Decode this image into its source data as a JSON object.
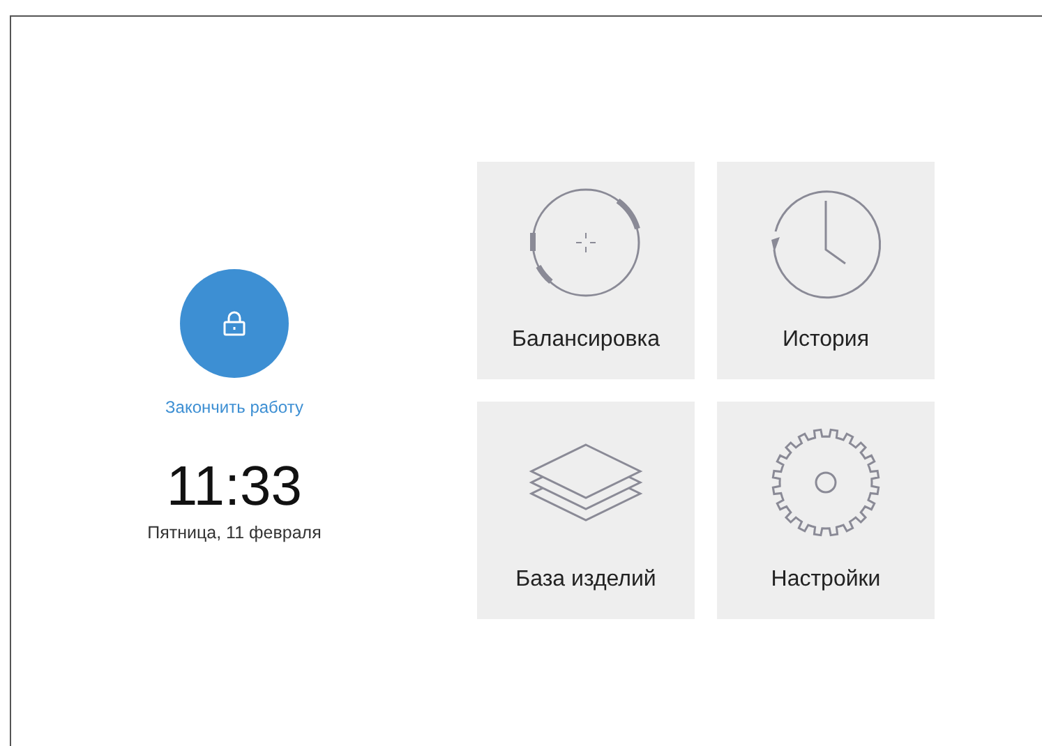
{
  "lock": {
    "label": "Закончить работу"
  },
  "clock": {
    "time": "11:33",
    "date": "Пятница, 11 февраля"
  },
  "tiles": [
    {
      "kind": "balancing",
      "label": "Балансировка"
    },
    {
      "kind": "history",
      "label": "История"
    },
    {
      "kind": "database",
      "label": "База изделий"
    },
    {
      "kind": "settings",
      "label": "Настройки"
    }
  ]
}
